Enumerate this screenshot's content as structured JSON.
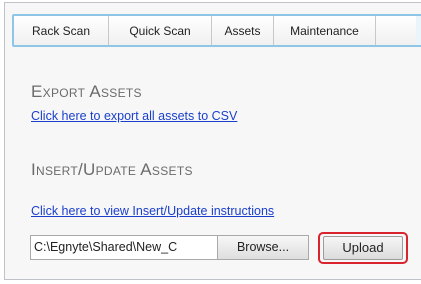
{
  "tabs": [
    {
      "label": "Rack Scan"
    },
    {
      "label": "Quick Scan"
    },
    {
      "label": "Assets"
    },
    {
      "label": "Maintenance"
    },
    {
      "label": ""
    }
  ],
  "export": {
    "heading": "Export Assets",
    "link": "Click here to export all assets to CSV"
  },
  "insert": {
    "heading": "Insert/Update Assets",
    "link": "Click here to view Insert/Update instructions"
  },
  "upload_form": {
    "file_path": "C:\\Egnyte\\Shared\\New_C",
    "browse_label": "Browse...",
    "upload_label": "Upload"
  },
  "colors": {
    "link": "#1a3fcc",
    "heading": "#6b6b6b",
    "highlight": "#d9232e",
    "tab_border": "#8fc6e8"
  }
}
